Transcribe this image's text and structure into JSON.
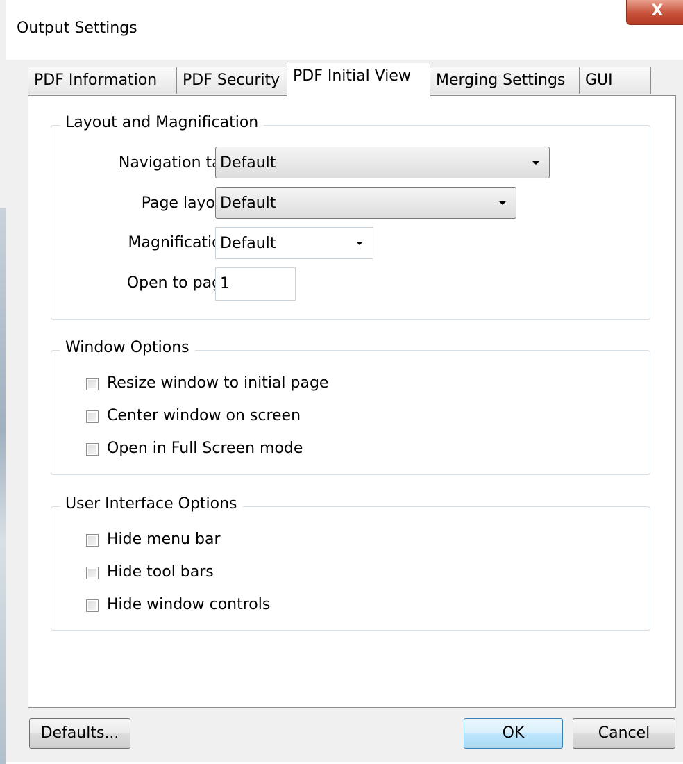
{
  "window": {
    "title": "Output Settings",
    "close_glyph": "X"
  },
  "tabs": [
    {
      "label": "PDF Information",
      "active": false
    },
    {
      "label": "PDF Security",
      "active": false
    },
    {
      "label": "PDF Initial View",
      "active": true
    },
    {
      "label": "Merging Settings",
      "active": false
    },
    {
      "label": "GUI",
      "active": false
    }
  ],
  "layout_group": {
    "title": "Layout and Magnification",
    "navigation_tab": {
      "label": "Navigation tab:",
      "value": "Default"
    },
    "page_layout": {
      "label": "Page layout:",
      "value": "Default"
    },
    "magnification": {
      "label": "Magnification:",
      "value": "Default"
    },
    "open_to_page": {
      "label": "Open to page:",
      "value": "1"
    }
  },
  "window_group": {
    "title": "Window Options",
    "options": [
      {
        "label": "Resize window to initial page",
        "checked": false
      },
      {
        "label": "Center window on screen",
        "checked": false
      },
      {
        "label": "Open in Full Screen mode",
        "checked": false
      }
    ]
  },
  "ui_group": {
    "title": "User Interface Options",
    "options": [
      {
        "label": "Hide menu bar",
        "checked": false
      },
      {
        "label": "Hide tool bars",
        "checked": false
      },
      {
        "label": "Hide window controls",
        "checked": false
      }
    ]
  },
  "buttons": {
    "defaults": "Defaults...",
    "ok": "OK",
    "cancel": "Cancel"
  }
}
